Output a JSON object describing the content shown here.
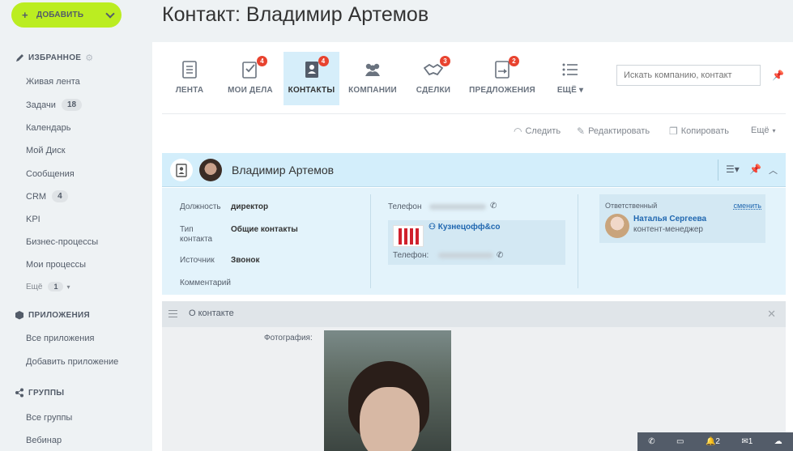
{
  "sidebar": {
    "add_label": "ДОБАВИТЬ",
    "favorites_title": "ИЗБРАННОЕ",
    "favorites": [
      {
        "label": "Живая лента"
      },
      {
        "label": "Задачи",
        "count": "18"
      },
      {
        "label": "Календарь"
      },
      {
        "label": "Мой Диск"
      },
      {
        "label": "Сообщения"
      },
      {
        "label": "CRM",
        "count": "4"
      },
      {
        "label": "KPI"
      },
      {
        "label": "Бизнес-процессы"
      },
      {
        "label": "Мои процессы"
      }
    ],
    "more_label": "Ещё",
    "more_count": "1",
    "apps_title": "ПРИЛОЖЕНИЯ",
    "apps": [
      {
        "label": "Все приложения"
      },
      {
        "label": "Добавить приложение"
      }
    ],
    "groups_title": "ГРУППЫ",
    "groups": [
      {
        "label": "Все группы"
      },
      {
        "label": "Вебинар"
      }
    ]
  },
  "page": {
    "title": "Контакт: Владимир Артемов"
  },
  "tabs": [
    {
      "label": "ЛЕНТА"
    },
    {
      "label": "МОИ ДЕЛА",
      "badge": "4"
    },
    {
      "label": "КОНТАКТЫ",
      "badge": "4"
    },
    {
      "label": "КОМПАНИИ"
    },
    {
      "label": "СДЕЛКИ",
      "badge": "3"
    },
    {
      "label": "ПРЕДЛОЖЕНИЯ",
      "badge": "2"
    },
    {
      "label": "ЕЩЁ"
    }
  ],
  "search": {
    "placeholder": "Искать компанию, контакт"
  },
  "actions": {
    "follow": "Следить",
    "edit": "Редактировать",
    "copy": "Копировать",
    "more": "Ещё"
  },
  "contact": {
    "name": "Владимир Артемов",
    "fields": {
      "position_label": "Должность",
      "position_value": "директор",
      "type_label": "Тип контакта",
      "type_value": "Общие контакты",
      "source_label": "Источник",
      "source_value": "Звонок",
      "comment_label": "Комментарий"
    },
    "phone_label": "Телефон",
    "company_name": "Кузнецофф&co",
    "company_phone_label": "Телефон:",
    "responsible_label": "Ответственный",
    "responsible_change": "сменить",
    "responsible_name": "Наталья Сергеева",
    "responsible_role": "контент-менеджер"
  },
  "about": {
    "title": "О контакте",
    "photo_label": "Фотография:"
  },
  "status": {
    "notifications": "2",
    "messages": "1"
  },
  "colors": {
    "accent": "#bbed21",
    "badge": "#e8432f",
    "card_header": "#d3eefb",
    "link": "#2067b0"
  }
}
